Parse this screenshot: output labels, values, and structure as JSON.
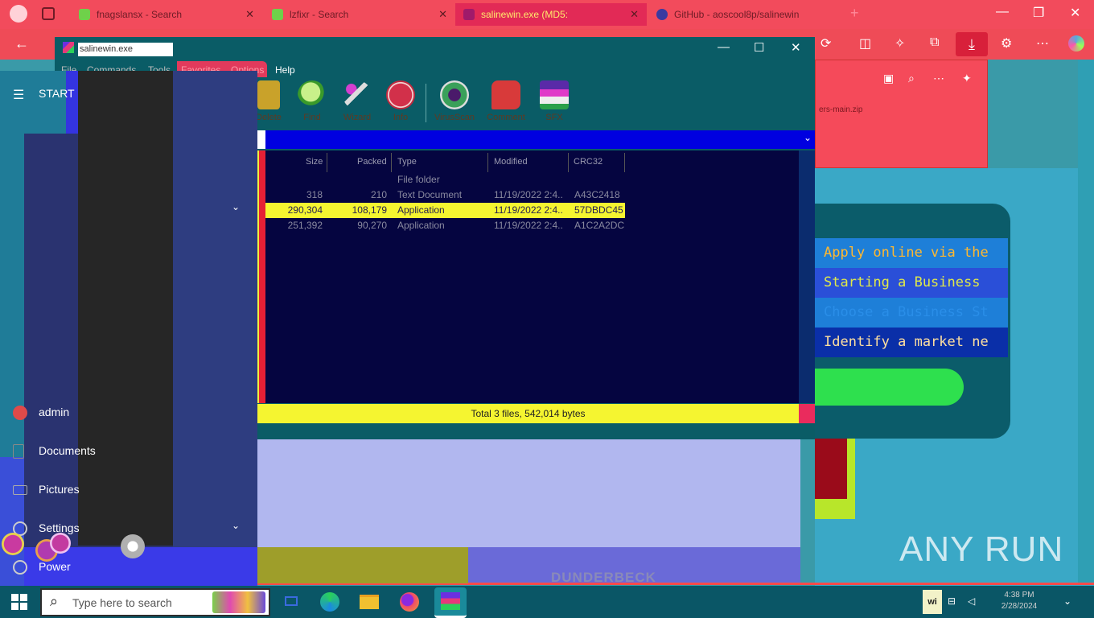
{
  "browser": {
    "tabs": [
      {
        "label": "fnagslansx - Search",
        "active": false
      },
      {
        "label": "lzfixr - Search",
        "active": false
      },
      {
        "label": "salinewin.exe (MD5:",
        "active": true
      },
      {
        "label": "GitHub - aoscool8p/salinewin",
        "active": false
      }
    ],
    "controls": {
      "minimize": "—",
      "restore": "❐",
      "close": "✕",
      "new_tab": "+",
      "back": "←"
    },
    "download_link": "ers-main.zip"
  },
  "webpage": {
    "items": [
      "Apply online via the",
      "Starting a Business",
      "Choose a Business St",
      "Identify a market ne"
    ],
    "colors": {
      "items": [
        "#ffb830",
        "#e0e84a",
        "#2a8ee8",
        "#ffe0a0"
      ]
    }
  },
  "winrar": {
    "title": "salinewin.exe",
    "controls": {
      "minimize": "—",
      "maximize": "☐",
      "close": "✕"
    },
    "menu": [
      "File",
      "Commands",
      "Tools",
      "Favorites",
      "Options",
      "Help"
    ],
    "toolbar": [
      "Delete",
      "Find",
      "Wizard",
      "Info",
      "VirusScan",
      "Comment",
      "SFX"
    ],
    "columns": [
      "Size",
      "Packed",
      "Type",
      "Modified",
      "CRC32"
    ],
    "rows": [
      {
        "size": "",
        "packed": "",
        "type": "File folder",
        "modified": "",
        "crc": "",
        "selected": false
      },
      {
        "size": "318",
        "packed": "210",
        "type": "Text Document",
        "modified": "11/19/2022 2:4...",
        "crc": "A43C2418",
        "selected": false
      },
      {
        "size": "290,304",
        "packed": "108,179",
        "type": "Application",
        "modified": "11/19/2022 2:4...",
        "crc": "57DBDC45",
        "selected": true
      },
      {
        "size": "251,392",
        "packed": "90,270",
        "type": "Application",
        "modified": "11/19/2022 2:4...",
        "crc": "A1C2A2DC",
        "selected": false
      }
    ],
    "status": "Total 3 files, 542,014 bytes"
  },
  "start_menu": {
    "label": "START",
    "items": [
      "admin",
      "Documents",
      "Pictures",
      "Settings",
      "Power"
    ]
  },
  "taskbar": {
    "search_placeholder": "Type here to search",
    "tray_label": "wi",
    "clock_time": "4:38 PM",
    "clock_date": "2/28/2024"
  },
  "watermark": "ANY RUN",
  "background_text": "DUNDERBECK"
}
